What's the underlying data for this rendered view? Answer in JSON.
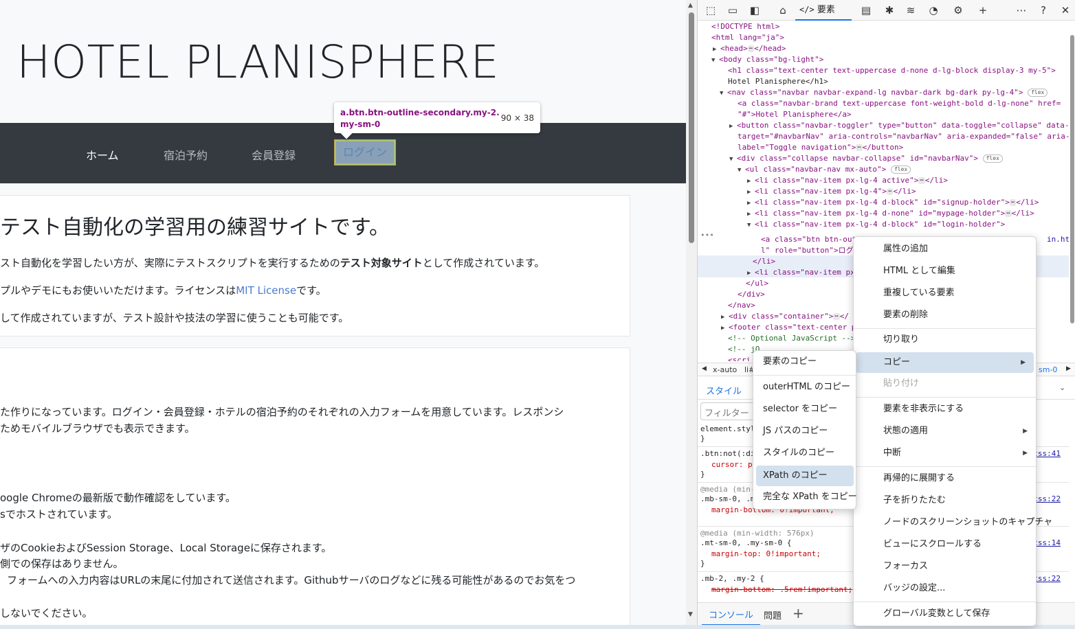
{
  "page": {
    "site_title": "HOTEL PLANISPHERE",
    "nav": {
      "home": "ホーム",
      "reserve": "宿泊予約",
      "signup": "会員登録",
      "login": "ログイン"
    },
    "tooltip": {
      "selector": "a.btn.btn-outline-secondary.my-2.my-sm-0",
      "size": "90 × 38"
    },
    "lead": "テスト自動化の学習用の練習サイトです。",
    "card1": {
      "p1_pre": "スト自動化を学習したい方が、実際にテストスクリプトを実行するための",
      "p1_bold": "テスト対象サイト",
      "p1_post": "として作成されています。",
      "p2_pre": "プルやデモにもお使いいただけます。ライセンスは",
      "p2_link": "MIT License",
      "p2_post": "です。",
      "p3": "して作成されていますが、テスト設計や技法の学習に使うことも可能です。"
    },
    "card2": {
      "l1": "た作りになっています。ログイン・会員登録・ホテルの宿泊予約のそれぞれの入力フォームを用意しています。レスポンシ",
      "l2": "ためモバイルブラウザでも表示できます。",
      "l3": "oogle Chromeの最新版で動作確認をしています。",
      "l4": "sでホストされています。",
      "l5": "ザのCookieおよびSession Storage、Local Storageに保存されます。",
      "l6": "側での保存はありません。",
      "l7": "フォームへの入力内容はURLの末尾に付加されて送信されます。Githubサーバのログなどに残る可能性があるのでお気をつ",
      "l8": "しないでください。"
    }
  },
  "devtools": {
    "toolbar": {
      "inspect_icon": "inspect-icon",
      "device_icon": "device-icon",
      "sidebar_icon": "sidebar-icon",
      "welcome_icon": "home-icon",
      "elements_tab": "要素",
      "console_icon": "console-icon",
      "sources_icon": "bug-icon",
      "network_icon": "wifi-icon",
      "performance_icon": "performance-icon",
      "settings_icon": "gear-icon",
      "more_tools_icon": "plus-icon",
      "menu_icon": "ellipsis-icon",
      "help_icon": "help-icon",
      "close_icon": "close-icon"
    },
    "dom": [
      "<!DOCTYPE html>",
      "<html lang=\"ja\">",
      "<head>",
      "</head>",
      "<body class=\"bg-light\">",
      "<h1 class=\"text-center text-uppercase d-none d-lg-block display-3 my-5\">",
      "Hotel Planisphere</h1>",
      "<nav class=\"navbar navbar-expand-lg navbar-dark bg-dark py-lg-4\">",
      "flex",
      "<a class=\"navbar-brand text-uppercase font-weight-bold d-lg-none\" href=",
      "\"#\">Hotel Planisphere</a>",
      "<button class=\"navbar-toggler\" type=\"button\" data-toggle=\"collapse\" data-",
      "target=\"#navbarNav\" aria-controls=\"navbarNav\" aria-expanded=\"false\" aria-",
      "label=\"Toggle navigation\">",
      "</button>",
      "<div class=\"collapse navbar-collapse\" id=\"navbarNav\">",
      "<ul class=\"navbar-nav mx-auto\">",
      "<li class=\"nav-item px-lg-4 active\">",
      "</li>",
      "<li class=\"nav-item px-lg-4\">",
      "<li class=\"nav-item px-lg-4 d-block\" id=\"signup-holder\">",
      "<li class=\"nav-item px-lg-4 d-none\" id=\"mypage-holder\">",
      "<li class=\"nav-item px-lg-4 d-block\" id=\"login-holder\">",
      "<a class=\"btn btn-out",
      "in.htm",
      "l\" role=\"button\">ログ",
      "</li>",
      "<li class=\"nav-item px",
      "</ul>",
      "</div>",
      "</nav>",
      "<div class=\"container\">",
      "</",
      "<footer class=\"text-center p",
      "<!-- Optional JavaScript -->",
      "<!-- jQ",
      "...",
      "<scri"
    ],
    "crumbs": {
      "left": "x-auto",
      "li": "li#",
      "right": "sm-0"
    },
    "styles_tab": "スタイル",
    "filter_placeholder": "フィルター",
    "css": {
      "element_style": "element.styl",
      "rule1_sel": ".btn:not(:di",
      "rule1_prop": "cursor: p",
      "rule1_src": "css:41",
      "media1": "@media (min-",
      "rule2_sel": ".mb-sm-0, .m",
      "rule2_prop": "margin-bottom: 0!important;",
      "rule2_src": "css:22",
      "media2": "@media (min-width: 576px)",
      "rule3_sel": ".mt-sm-0, .my-sm-0 {",
      "rule3_prop": "margin-top: 0!important;",
      "rule3_src": "css:14",
      "rule4_sel": ".mb-2, .my-2 {",
      "rule4_prop": "margin-bottom: .5rem!important;",
      "rule4_src": "css:22",
      "brace": "}"
    },
    "drawer": {
      "console": "コンソール",
      "issues": "問題",
      "add": "+"
    }
  },
  "context_menu": {
    "items": [
      "属性の追加",
      "HTML として編集",
      "重複している要素",
      "要素の削除",
      "切り取り",
      "コピー",
      "貼り付け",
      "要素を非表示にする",
      "状態の適用",
      "中断",
      "再帰的に展開する",
      "子を折りたたむ",
      "ノードのスクリーンショットのキャプチャ",
      "ビューにスクロールする",
      "フォーカス",
      "バッジの設定...",
      "グローバル変数として保存"
    ]
  },
  "copy_submenu": {
    "items": [
      "要素のコピー",
      "outerHTML のコピー",
      "selector をコピー",
      "JS パスのコピー",
      "スタイルのコピー",
      "XPath のコピー",
      "完全な XPath をコピー"
    ]
  }
}
